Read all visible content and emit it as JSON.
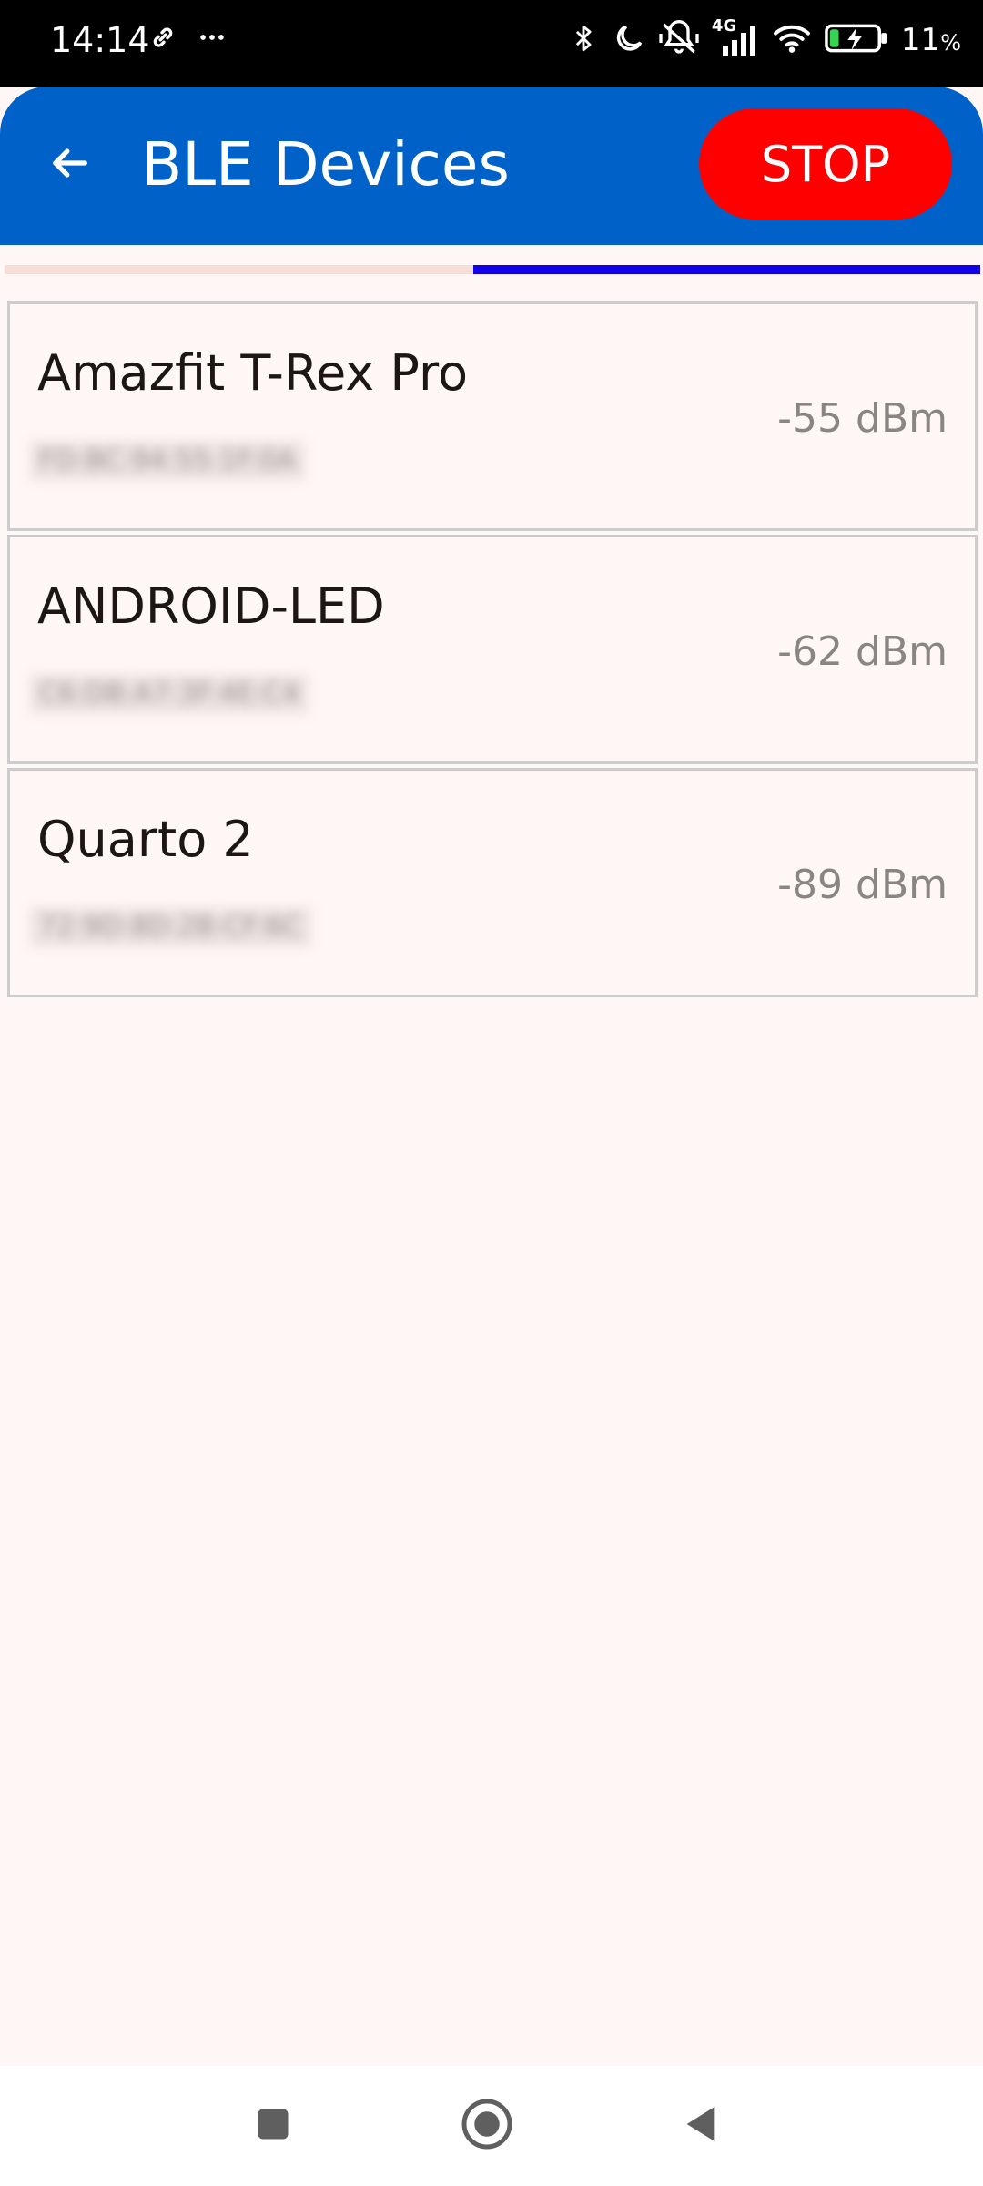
{
  "status_bar": {
    "time": "14:14",
    "battery_percent": "11",
    "battery_suffix": "%",
    "network_label": "4G",
    "icons": [
      "link-icon",
      "more-icon",
      "bluetooth-icon",
      "moon-icon",
      "vibrate-off-icon",
      "signal-icon",
      "wifi-icon",
      "battery-charging-icon"
    ]
  },
  "app_bar": {
    "title": "BLE Devices",
    "back_icon": "arrow-back-icon",
    "stop_label": "STOP"
  },
  "scan_progress": {
    "state": "indeterminate",
    "visible_segment": [
      0.48,
      1.0
    ]
  },
  "devices": [
    {
      "name": "Amazfit T-Rex Pro",
      "address": "FD:BC:94:55:1F:0A",
      "rssi": "-55 dBm"
    },
    {
      "name": "ANDROID-LED",
      "address": "C6:DB:A7:3F:4E:C4",
      "rssi": "-62 dBm"
    },
    {
      "name": "Quarto 2",
      "address": "72:9D:8D:2B:CF:6C",
      "rssi": "-89 dBm"
    }
  ],
  "colors": {
    "app_bar": "#0062c8",
    "stop_button": "#fe0000",
    "progress_fill": "#1200e8",
    "progress_track": "#f6ddd6",
    "background": "#fff7f5"
  },
  "nav_bar": {
    "icons": [
      "recents-square-icon",
      "home-circle-icon",
      "back-triangle-icon"
    ]
  }
}
